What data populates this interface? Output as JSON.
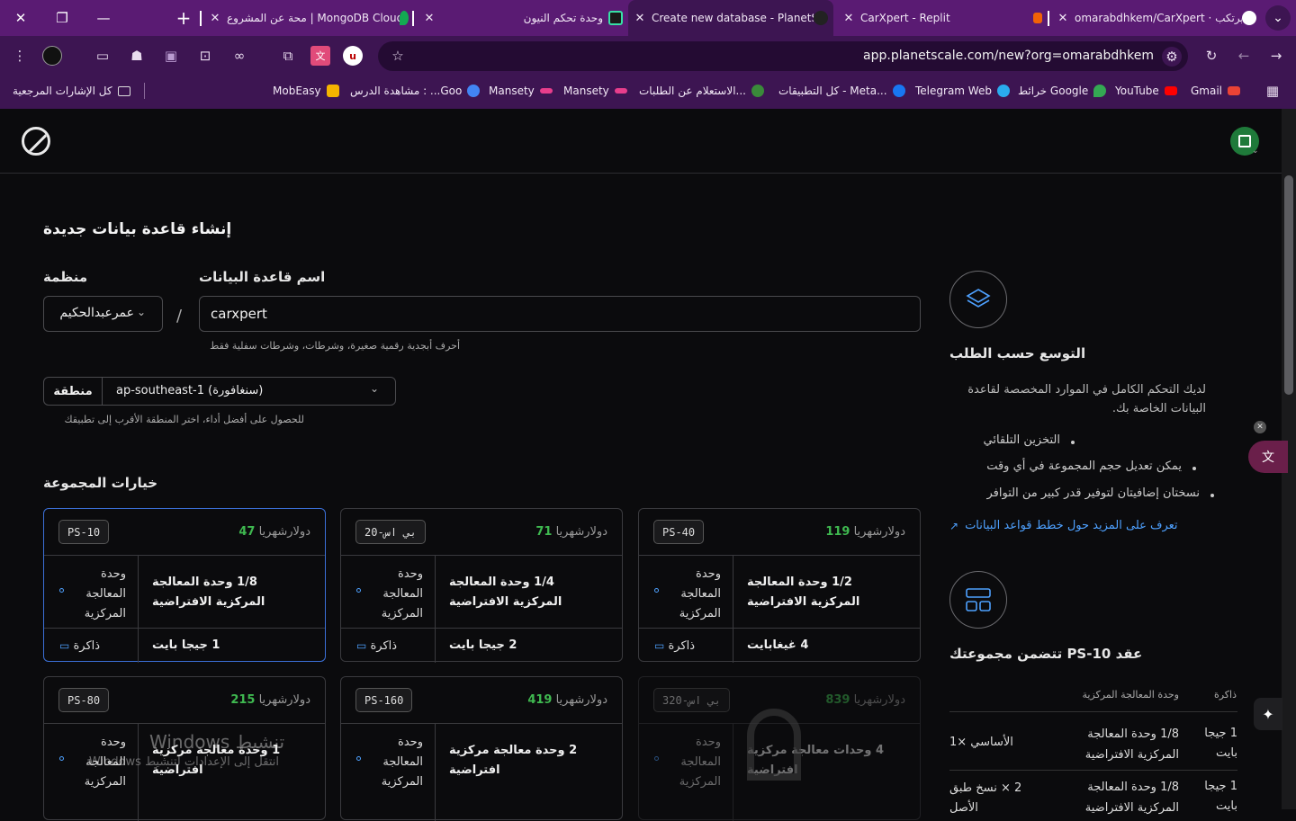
{
  "tabs": [
    {
      "title": "omarabdhkem/CarXpert · يرتكب",
      "close": "✕"
    },
    {
      "title": "CarXpert - Replit",
      "close": "✕"
    },
    {
      "title": "Create new database - PlanetScale",
      "close": "✕"
    },
    {
      "title": "وحدة تحكم النيون",
      "close": "✕"
    },
    {
      "title": "محة عن المشروع | MongoDB Cloud",
      "close": "✕"
    }
  ],
  "window": {
    "close": "✕",
    "restore": "❐",
    "minimize": "—",
    "new_tab": "+",
    "tab_menu": "⌄"
  },
  "address": {
    "url": "app.planetscale.com/new?org=omarabdhkem"
  },
  "bookmarks": [
    {
      "label": "Gmail",
      "icon": "gmail-icon",
      "color": "#ea4335"
    },
    {
      "label": "YouTube",
      "icon": "youtube-icon",
      "color": "#ff0000"
    },
    {
      "label": "خرائط Google",
      "icon": "maps-icon",
      "color": "#34a853"
    },
    {
      "label": "Telegram Web",
      "icon": "telegram-icon",
      "color": "#2aabee"
    },
    {
      "label": "كل التطبيقات - Meta...",
      "icon": "facebook-icon",
      "color": "#1877f2"
    },
    {
      "label": "الاستعلام عن الطلبات...",
      "icon": "query-icon",
      "color": "#3a8a3a"
    },
    {
      "label": "Mansety",
      "icon": "mansety-icon",
      "color": "#e83e8c"
    },
    {
      "label": "Mansety",
      "icon": "mansety-icon",
      "color": "#e83e8c"
    },
    {
      "label": "مشاهدة الدرس : ...Goo",
      "icon": "google-icon",
      "color": "#4285f4"
    },
    {
      "label": "MobEasy",
      "icon": "mobeasy-icon",
      "color": "#f5b400"
    }
  ],
  "all_bookmarks": "كل الإشارات المرجعية",
  "page": {
    "title": "إنشاء قاعدة بيانات جديدة",
    "org_label": "منظمة",
    "org_value": "عمرعبدالحكيم",
    "db_label": "اسم قاعدة البيانات",
    "db_value": "carxpert",
    "slash": "/",
    "db_hint": "أحرف أبجدية رقمية صغيرة، وشرطات، وشرطات سفلية فقط",
    "region_label": "منطقة",
    "region_value": "ap-southeast-1 (سنغافورة)",
    "region_hint": "للحصول على أفضل أداء، اختر المنطقة الأقرب إلى تطبيقك",
    "cluster_title": "خيارات المجموعة"
  },
  "cards": [
    {
      "badge": "PS-10",
      "price_unit": "دولارشهريا",
      "price": "47",
      "cpu": "1/8 وحدة المعالجة المركزية الافتراضية",
      "mem": "1 جيجا بايت",
      "selected": true,
      "locked": false
    },
    {
      "badge": "بي اس-20",
      "price_unit": "دولارشهريا",
      "price": "71",
      "cpu": "1/4 وحدة المعالجة المركزية الافتراضية",
      "mem": "2 جيجا بايت",
      "selected": false,
      "locked": false
    },
    {
      "badge": "PS-40",
      "price_unit": "دولارشهريا",
      "price": "119",
      "cpu": "1/2 وحدة المعالجة المركزية الافتراضية",
      "mem": "4 غيغابايت",
      "selected": false,
      "locked": false
    },
    {
      "badge": "PS-80",
      "price_unit": "دولارشهريا",
      "price": "215",
      "cpu": "1 وحدة معالجة مركزية افتراضية",
      "mem": "",
      "selected": false,
      "locked": false
    },
    {
      "badge": "PS-160",
      "price_unit": "دولارشهريا",
      "price": "419",
      "cpu": "2 وحدة معالجة مركزية افتراضية",
      "mem": "",
      "selected": false,
      "locked": false
    },
    {
      "badge": "بي اس-320",
      "price_unit": "دولارشهريا",
      "price": "839",
      "cpu": "4 وحدات معالجة مركزية افتراضية",
      "mem": "",
      "selected": false,
      "locked": true
    }
  ],
  "card_labels": {
    "cpu": "وحدة المعالجة المركزية",
    "mem": "ذاكرة"
  },
  "side": {
    "scale_title": "التوسع حسب الطلب",
    "scale_desc": "لديك التحكم الكامل في الموارد المخصصة لقاعدة البيانات الخاصة بك.",
    "bullets": [
      "التخزين التلقائي",
      "يمكن تعديل حجم المجموعة في أي وقت",
      "نسختان إضافيتان لتوفير قدر كبير من التوافر"
    ],
    "learn_more": "تعرف على المزيد حول خطط قواعد البيانات",
    "cluster_title": "عقد PS-10 تتضمن مجموعتك",
    "col_mem": "ذاكرة",
    "col_cpu": "وحدة المعالجة المركزية",
    "rows": [
      {
        "mem": "1 جيجا بايت",
        "cpu": "1/8 وحدة المعالجة المركزية الافتراضية",
        "type": "الأساسي ×1"
      },
      {
        "mem": "1 جيجا بايت",
        "cpu": "1/8 وحدة المعالجة المركزية الافتراضية",
        "type": "2 × نسخ طبق الأصل"
      }
    ]
  },
  "watermark": {
    "title": "تنشيط Windows",
    "sub": "انتقل إلى الإعدادات لتنشيط Windows."
  }
}
